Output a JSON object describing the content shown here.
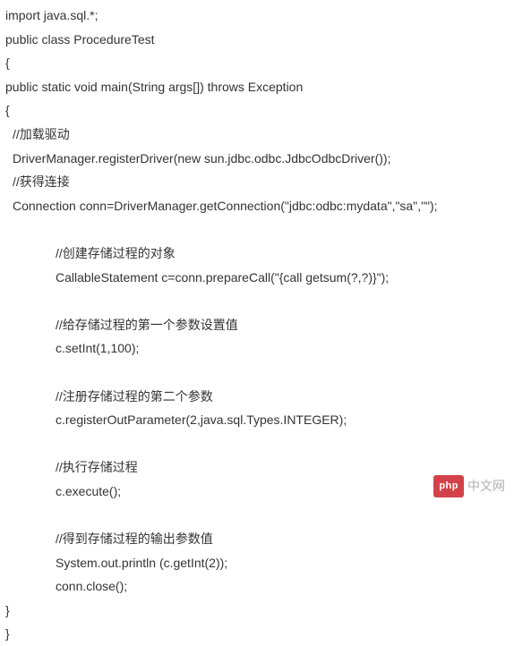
{
  "code": {
    "l01": "import java.sql.*;",
    "l02": "public class ProcedureTest",
    "l03": "{",
    "l04": "public static void main(String args[]) throws Exception",
    "l05": "{",
    "l06": "//加载驱动",
    "l07": "DriverManager.registerDriver(new sun.jdbc.odbc.JdbcOdbcDriver());",
    "l08": "//获得连接",
    "l09": "Connection conn=DriverManager.getConnection(\"jdbc:odbc:mydata\",\"sa\",\"\");",
    "l10": "//创建存储过程的对象",
    "l11": "CallableStatement c=conn.prepareCall(\"{call getsum(?,?)}\");",
    "l12": "//给存储过程的第一个参数设置值",
    "l13": "c.setInt(1,100);",
    "l14": "//注册存储过程的第二个参数",
    "l15": "c.registerOutParameter(2,java.sql.Types.INTEGER);",
    "l16": "//执行存储过程",
    "l17": "c.execute();",
    "l18": "//得到存储过程的输出参数值",
    "l19": "System.out.println (c.getInt(2));",
    "l20": "conn.close();",
    "l21": "}",
    "l22": "}"
  },
  "watermark": {
    "badge": "php",
    "text": "中文网"
  }
}
